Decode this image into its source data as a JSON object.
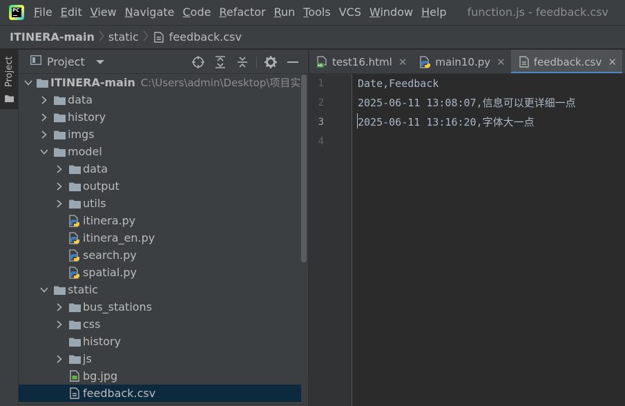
{
  "menubar": {
    "items": [
      {
        "u": "F",
        "rest": "ile"
      },
      {
        "u": "E",
        "rest": "dit"
      },
      {
        "u": "V",
        "rest": "iew"
      },
      {
        "u": "N",
        "rest": "avigate"
      },
      {
        "u": "C",
        "rest": "ode"
      },
      {
        "u": "R",
        "rest": "efactor"
      },
      {
        "u": "R",
        "rest": "un"
      },
      {
        "u": "T",
        "rest": "ools"
      },
      {
        "u": "",
        "rest": "VCS"
      },
      {
        "u": "W",
        "rest": "indow"
      },
      {
        "u": "H",
        "rest": "elp"
      }
    ],
    "window_title": "function.js - feedback.csv"
  },
  "breadcrumb": {
    "root": "ITINERA-main",
    "folder": "static",
    "file": "feedback.csv"
  },
  "stripe": {
    "project_label": "Project"
  },
  "panel": {
    "title": "Project"
  },
  "tree": [
    {
      "label": "ITINERA-main",
      "hint": "C:\\Users\\admin\\Desktop\\项目实训\\",
      "kind": "folder",
      "state": "open",
      "bold": true
    },
    {
      "label": "data",
      "kind": "folder",
      "state": "closed"
    },
    {
      "label": "history",
      "kind": "folder",
      "state": "closed"
    },
    {
      "label": "imgs",
      "kind": "folder",
      "state": "closed"
    },
    {
      "label": "model",
      "kind": "folder",
      "state": "open"
    },
    {
      "label": "data",
      "kind": "folder",
      "state": "closed"
    },
    {
      "label": "output",
      "kind": "folder",
      "state": "closed"
    },
    {
      "label": "utils",
      "kind": "folder",
      "state": "closed"
    },
    {
      "label": "itinera.py",
      "kind": "py"
    },
    {
      "label": "itinera_en.py",
      "kind": "py"
    },
    {
      "label": "search.py",
      "kind": "py"
    },
    {
      "label": "spatial.py",
      "kind": "py"
    },
    {
      "label": "static",
      "kind": "folder",
      "state": "open"
    },
    {
      "label": "bus_stations",
      "kind": "folder",
      "state": "closed"
    },
    {
      "label": "css",
      "kind": "folder",
      "state": "closed"
    },
    {
      "label": "history",
      "kind": "folder",
      "state": "none"
    },
    {
      "label": "js",
      "kind": "folder",
      "state": "closed"
    },
    {
      "label": "bg.jpg",
      "kind": "img"
    },
    {
      "label": "feedback.csv",
      "kind": "csv",
      "selected": true
    }
  ],
  "tabs": [
    {
      "label": "test16.html",
      "kind": "html"
    },
    {
      "label": "main10.py",
      "kind": "py"
    },
    {
      "label": "feedback.csv",
      "kind": "csv",
      "active": true
    }
  ],
  "editor": {
    "line_numbers": [
      "1",
      "2",
      "3",
      "4"
    ],
    "current_line": 3,
    "lines": [
      "Date,Feedback",
      "2025-06-11 13:08:07,信息可以更详细一点",
      "2025-06-11 13:16:20,字体大一点",
      ""
    ]
  },
  "colors": {
    "accent": "#4a88c7",
    "selection": "#0d293e",
    "panel_bg": "#3c3f41",
    "editor_bg": "#2b2b2b"
  }
}
